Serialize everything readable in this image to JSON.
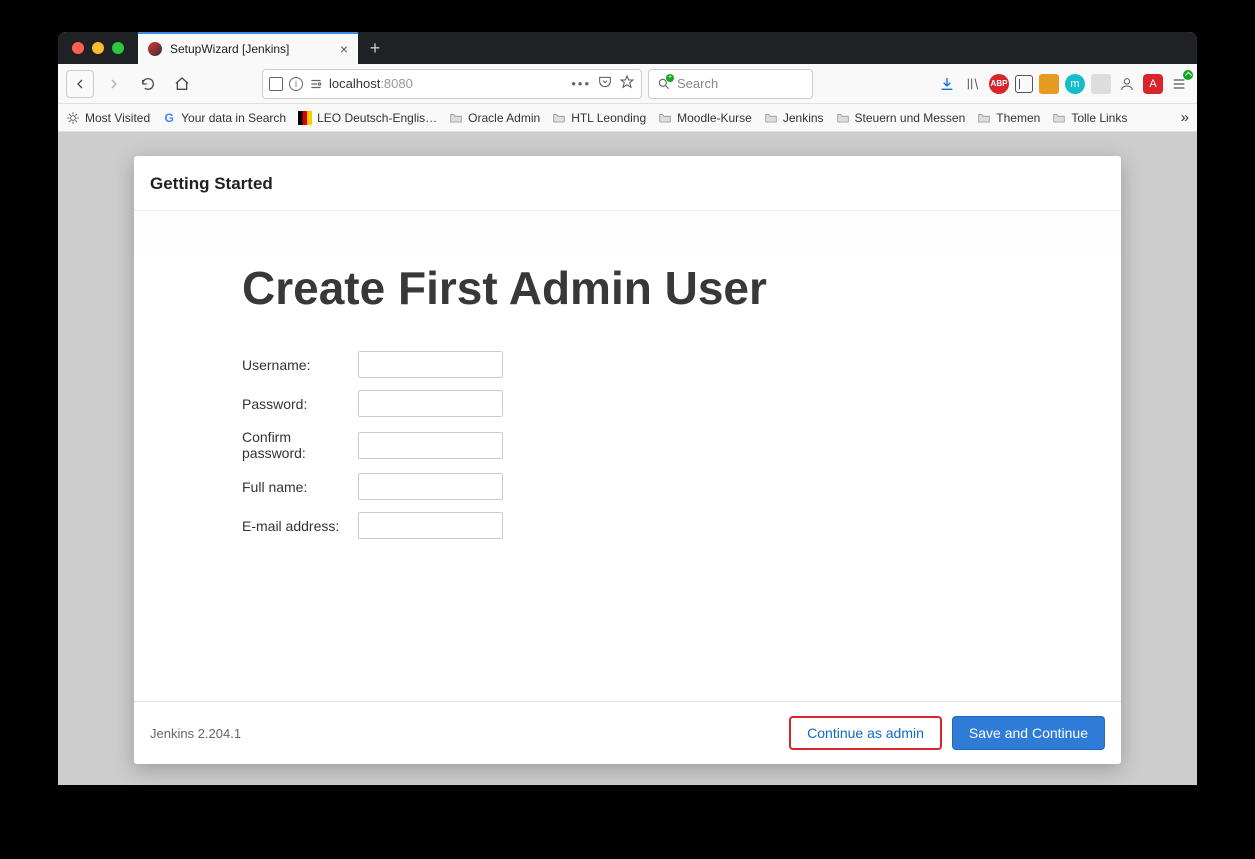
{
  "browser": {
    "tab_title": "SetupWizard [Jenkins]",
    "url_host": "localhost",
    "url_port": ":8080",
    "search_placeholder": "Search"
  },
  "bookmarks": [
    {
      "label": "Most Visited",
      "icon": "star"
    },
    {
      "label": "Your data in Search",
      "icon": "g"
    },
    {
      "label": "LEO Deutsch-Englis…",
      "icon": "leo"
    },
    {
      "label": "Oracle Admin",
      "icon": "folder"
    },
    {
      "label": "HTL Leonding",
      "icon": "folder"
    },
    {
      "label": "Moodle-Kurse",
      "icon": "folder"
    },
    {
      "label": "Jenkins",
      "icon": "folder"
    },
    {
      "label": "Steuern und Messen",
      "icon": "folder"
    },
    {
      "label": "Themen",
      "icon": "folder"
    },
    {
      "label": "Tolle Links",
      "icon": "folder"
    }
  ],
  "wizard": {
    "header": "Getting Started",
    "title": "Create First Admin User",
    "fields": {
      "username_label": "Username:",
      "password_label": "Password:",
      "confirm_label": "Confirm password:",
      "fullname_label": "Full name:",
      "email_label": "E-mail address:"
    },
    "footer_version": "Jenkins 2.204.1",
    "continue_admin": "Continue as admin",
    "save_continue": "Save and Continue"
  }
}
